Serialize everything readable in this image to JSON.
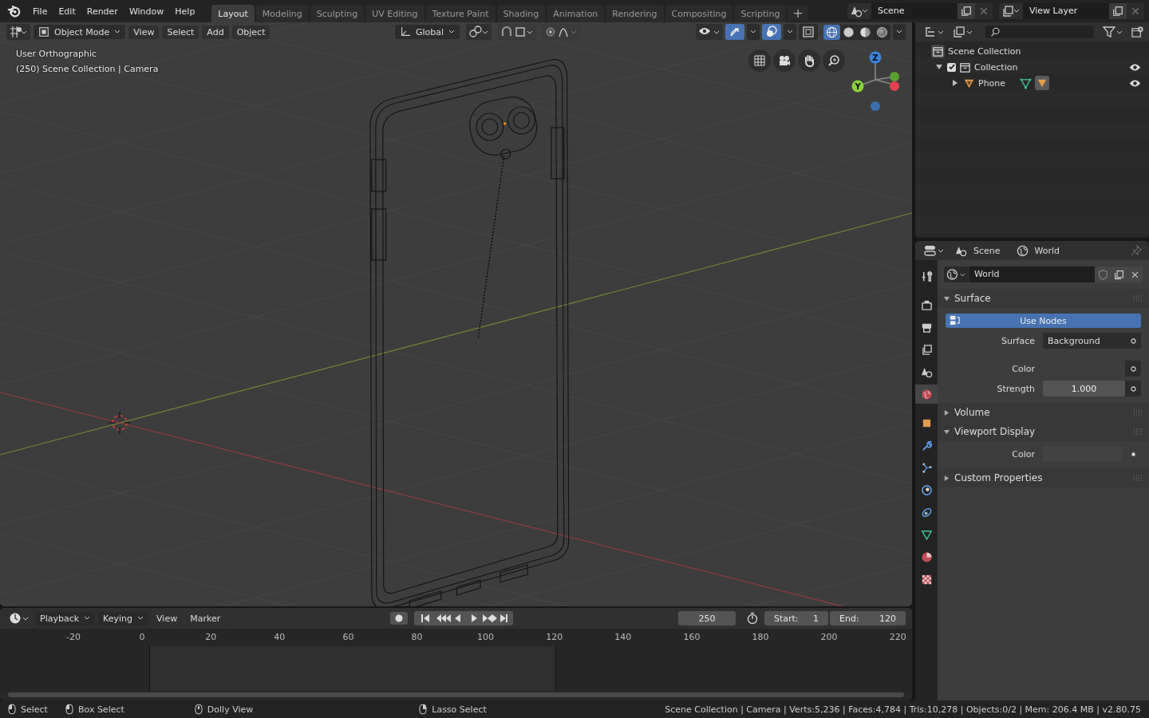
{
  "menu": [
    "File",
    "Edit",
    "Render",
    "Window",
    "Help"
  ],
  "workspaces": [
    {
      "label": "Layout",
      "selected": true
    },
    {
      "label": "Modeling",
      "selected": false
    },
    {
      "label": "Sculpting",
      "selected": false
    },
    {
      "label": "UV Editing",
      "selected": false
    },
    {
      "label": "Texture Paint",
      "selected": false
    },
    {
      "label": "Shading",
      "selected": false
    },
    {
      "label": "Animation",
      "selected": false
    },
    {
      "label": "Rendering",
      "selected": false
    },
    {
      "label": "Compositing",
      "selected": false
    },
    {
      "label": "Scripting",
      "selected": false
    }
  ],
  "add_workspace": "+",
  "scene": "Scene",
  "view_layer": "View Layer",
  "viewport": {
    "mode": "Object Mode",
    "menus": [
      "View",
      "Select",
      "Add",
      "Object"
    ],
    "orientation": "Global",
    "toggles": [
      {
        "kind": "gizmos",
        "on": true
      },
      {
        "kind": "overlays",
        "on": true
      },
      {
        "kind": "xray",
        "on": false
      }
    ],
    "shading": [
      {
        "kind": "wireframe",
        "selected": true
      },
      {
        "kind": "solid",
        "selected": false
      },
      {
        "kind": "material",
        "selected": false
      },
      {
        "kind": "rendered",
        "selected": false
      }
    ],
    "overlay_text": [
      "User Orthographic",
      "(250) Scene Collection | Camera"
    ],
    "axes": [
      {
        "label": "Z"
      },
      {
        "label": "Y"
      }
    ]
  },
  "outliner": {
    "tree": [
      {
        "kind": "scene_collection",
        "label": "Scene Collection",
        "children": [
          {
            "kind": "collection",
            "label": "Collection",
            "checked": true,
            "expanded": true,
            "visible": true,
            "children": [
              {
                "kind": "object",
                "label": "Phone",
                "expanded": false,
                "visible": true
              }
            ]
          }
        ]
      }
    ]
  },
  "properties": {
    "breadcrumb": [
      "Scene",
      "World"
    ],
    "tabs": [
      {
        "kind": "tool",
        "selected": false
      },
      {
        "kind": "render",
        "selected": false
      },
      {
        "kind": "output",
        "selected": false
      },
      {
        "kind": "view_layer",
        "selected": false
      },
      {
        "kind": "scene",
        "selected": false
      },
      {
        "kind": "world",
        "selected": true
      },
      {
        "kind": "object",
        "selected": false
      },
      {
        "kind": "modifiers",
        "selected": false
      },
      {
        "kind": "particles",
        "selected": false
      },
      {
        "kind": "physics",
        "selected": false
      },
      {
        "kind": "constraints",
        "selected": false
      },
      {
        "kind": "data",
        "selected": false
      },
      {
        "kind": "material",
        "selected": false
      },
      {
        "kind": "texture",
        "selected": false
      }
    ],
    "datablock": "World",
    "panels": [
      {
        "title": "Surface",
        "expanded": true,
        "rows": [
          {
            "kind": "toggle",
            "label": "Use Nodes",
            "on": true
          },
          {
            "kind": "enum",
            "label": "Surface",
            "value": "Background"
          },
          {
            "kind": "socket",
            "label": "Color"
          },
          {
            "kind": "number",
            "label": "Strength",
            "value": "1.000"
          }
        ]
      },
      {
        "title": "Volume",
        "expanded": false
      },
      {
        "title": "Viewport Display",
        "expanded": true,
        "rows": [
          {
            "kind": "swatch",
            "label": "Color"
          }
        ]
      },
      {
        "title": "Custom Properties",
        "expanded": false
      }
    ]
  },
  "timeline": {
    "menus": [
      "Playback",
      "Keying",
      "View",
      "Marker"
    ],
    "current_frame": "250",
    "start_label": "Start:",
    "start": "1",
    "end_label": "End:",
    "end": "120",
    "ticks": [
      "-20",
      "0",
      "20",
      "40",
      "60",
      "80",
      "100",
      "120",
      "140",
      "160",
      "180",
      "200",
      "220"
    ]
  },
  "status": {
    "hints": [
      "Select",
      "Box Select",
      "Dolly View",
      "Lasso Select"
    ],
    "stats": "Scene Collection | Camera | Verts:5,236 | Faces:4,784 | Tris:10,278 | Objects:0/2 | Mem: 206.4 MB | v2.80.75"
  }
}
